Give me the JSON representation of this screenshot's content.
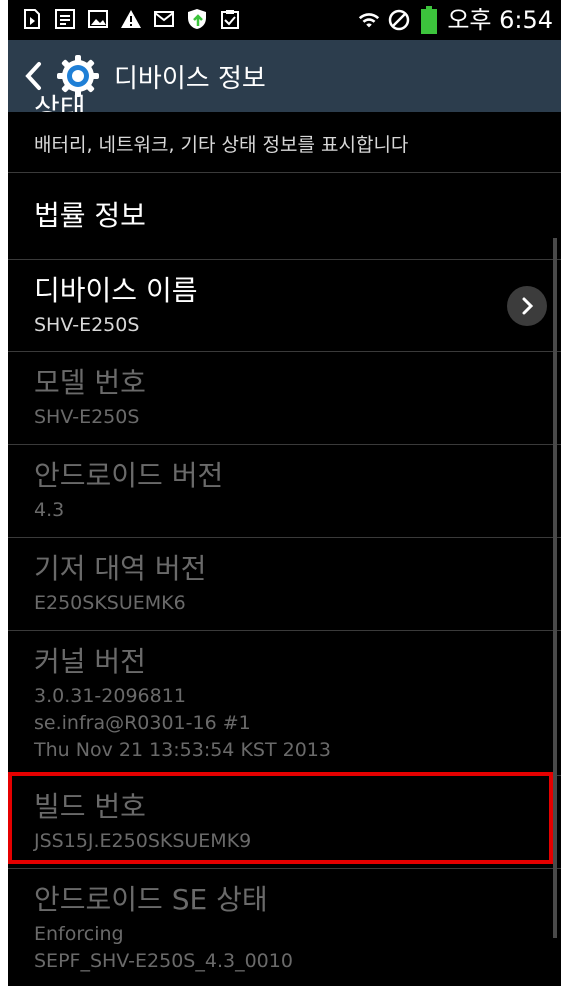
{
  "status_bar": {
    "time": "오후 6:54",
    "icons_left": [
      "download-icon",
      "sticky-icon",
      "image-icon",
      "warning-icon",
      "mail-icon",
      "security-update-icon",
      "clipboard-check-icon"
    ],
    "icons_right": [
      "wifi-icon",
      "do-not-disturb-icon",
      "battery-icon"
    ],
    "battery_color": "#3cc43c"
  },
  "action_bar": {
    "title": "디바이스 정보",
    "color": "#2c3d4d"
  },
  "list": {
    "items": [
      {
        "title": "상태",
        "subtitle": "배터리, 네트워크, 기타 상태 정보를 표시합니다"
      },
      {
        "title": "법률 정보"
      },
      {
        "title": "디바이스 이름",
        "subtitle": "SHV-E250S"
      },
      {
        "title": "모델 번호",
        "subtitle": "SHV-E250S"
      },
      {
        "title": "안드로이드 버전",
        "subtitle": "4.3"
      },
      {
        "title": "기저 대역 버전",
        "subtitle": "E250SKSUEMK6"
      },
      {
        "title": "커널 버전",
        "lines": [
          "3.0.31-2096811",
          "se.infra@R0301-16 #1",
          "Thu Nov 21 13:53:54 KST 2013"
        ]
      },
      {
        "title": "빌드 번호",
        "subtitle": "JSS15J.E250SKSUEMK9"
      },
      {
        "title": "안드로이드 SE 상태",
        "lines": [
          "Enforcing",
          "SEPF_SHV-E250S_4.3_0010"
        ]
      }
    ]
  },
  "highlight_color": "#e50000"
}
